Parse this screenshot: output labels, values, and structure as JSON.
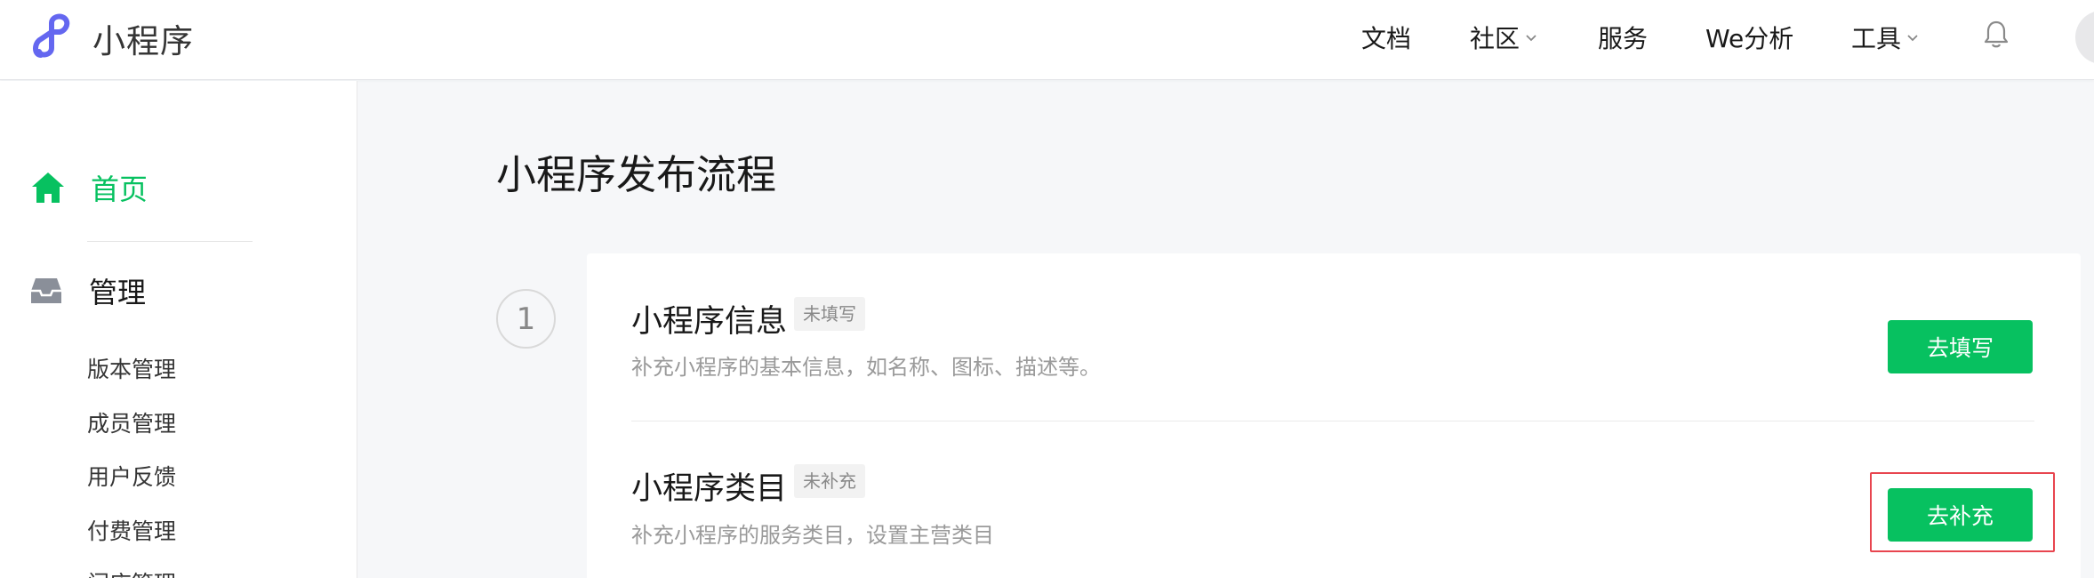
{
  "header": {
    "brand": "小程序",
    "nav": [
      {
        "label": "文档",
        "has_dropdown": false
      },
      {
        "label": "社区",
        "has_dropdown": true
      },
      {
        "label": "服务",
        "has_dropdown": false
      },
      {
        "label": "We分析",
        "has_dropdown": false
      },
      {
        "label": "工具",
        "has_dropdown": true
      }
    ],
    "icons": {
      "logo": "mini-program-logo-icon",
      "bell": "bell-icon",
      "avatar": "avatar"
    },
    "colors": {
      "logo": "#6467f0"
    }
  },
  "sidebar": {
    "home_label": "首页",
    "manage_label": "管理",
    "sub_items": [
      "版本管理",
      "成员管理",
      "用户反馈",
      "付费管理",
      "门店管理"
    ],
    "colors": {
      "active": "#07c160",
      "icon_inactive": "#8a8f99"
    }
  },
  "main": {
    "title": "小程序发布流程",
    "step_number": "1",
    "items": [
      {
        "title": "小程序信息",
        "tag": "未填写",
        "desc": "补充小程序的基本信息，如名称、图标、描述等。",
        "button": "去填写"
      },
      {
        "title": "小程序类目",
        "tag": "未补充",
        "desc": "补充小程序的服务类目，设置主营类目",
        "button": "去补充"
      }
    ],
    "colors": {
      "primary_button": "#07c160",
      "highlight_border": "#e8454f"
    }
  }
}
